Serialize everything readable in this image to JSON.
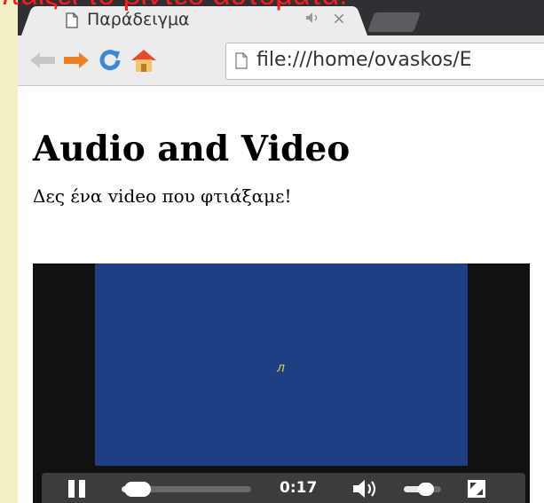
{
  "slide": {
    "caption": "παίζει το βίντεο αυτόματα.",
    "caption_color": "#ff1a1a",
    "background_color": "#f2f0c4"
  },
  "browser": {
    "tab": {
      "icon": "page-icon",
      "title": "Παράδειγμα",
      "audio_icon": "audio-playing-icon",
      "close_label": "×"
    },
    "toolbar": {
      "back_icon": "back-arrow-icon",
      "forward_icon": "forward-arrow-icon",
      "reload_icon": "reload-icon",
      "home_icon": "home-icon"
    },
    "address_bar": {
      "url": "file:///home/ovaskos/E"
    }
  },
  "page": {
    "heading": "Audio and Video",
    "text": "Δες ένα video που φτιάξαμε!"
  },
  "video_player": {
    "frame_color": "#1f3f85",
    "frame_mark": "л",
    "pause_icon": "pause-icon",
    "progress": 0.12,
    "time": "0:17",
    "volume_icon": "volume-icon",
    "volume_level": 0.6,
    "fullscreen_icon": "fullscreen-icon"
  }
}
